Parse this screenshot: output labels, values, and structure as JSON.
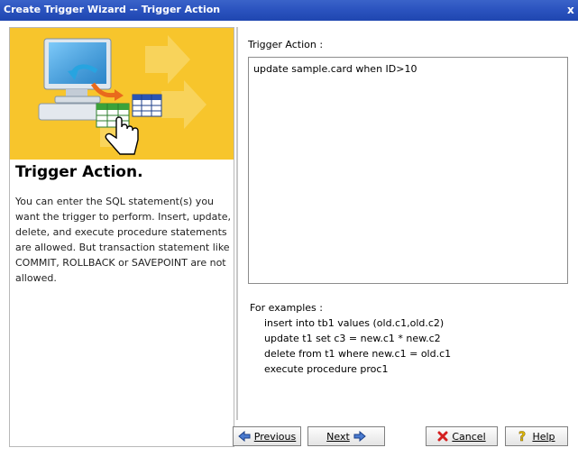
{
  "window": {
    "title": "Create Trigger Wizard -- Trigger Action",
    "close_glyph": "x"
  },
  "left_panel": {
    "heading": "Trigger Action.",
    "description": "You can enter the SQL statement(s) you want the trigger to perform. Insert, update, delete, and execute procedure statements are allowed. But transaction statement like COMMIT, ROLLBACK or SAVEPOINT are not allowed.",
    "banner_icon": "monitor-table-hand-illustration",
    "banner_color": "#f7c52c"
  },
  "form": {
    "label": "Trigger Action :",
    "value": "update sample.card when ID>10"
  },
  "examples": {
    "heading": "For examples :",
    "lines": [
      "insert into tb1 values (old.c1,old.c2)",
      "update t1 set c3 = new.c1 * new.c2",
      "delete from t1 where new.c1 = old.c1",
      "execute procedure proc1"
    ]
  },
  "buttons": {
    "previous": {
      "label": "Previous",
      "icon": "arrow-left-icon"
    },
    "next": {
      "label": "Next",
      "icon": "arrow-right-icon"
    },
    "cancel": {
      "label": "Cancel",
      "icon": "red-x-icon"
    },
    "help": {
      "label": "Help",
      "icon": "question-icon"
    }
  }
}
